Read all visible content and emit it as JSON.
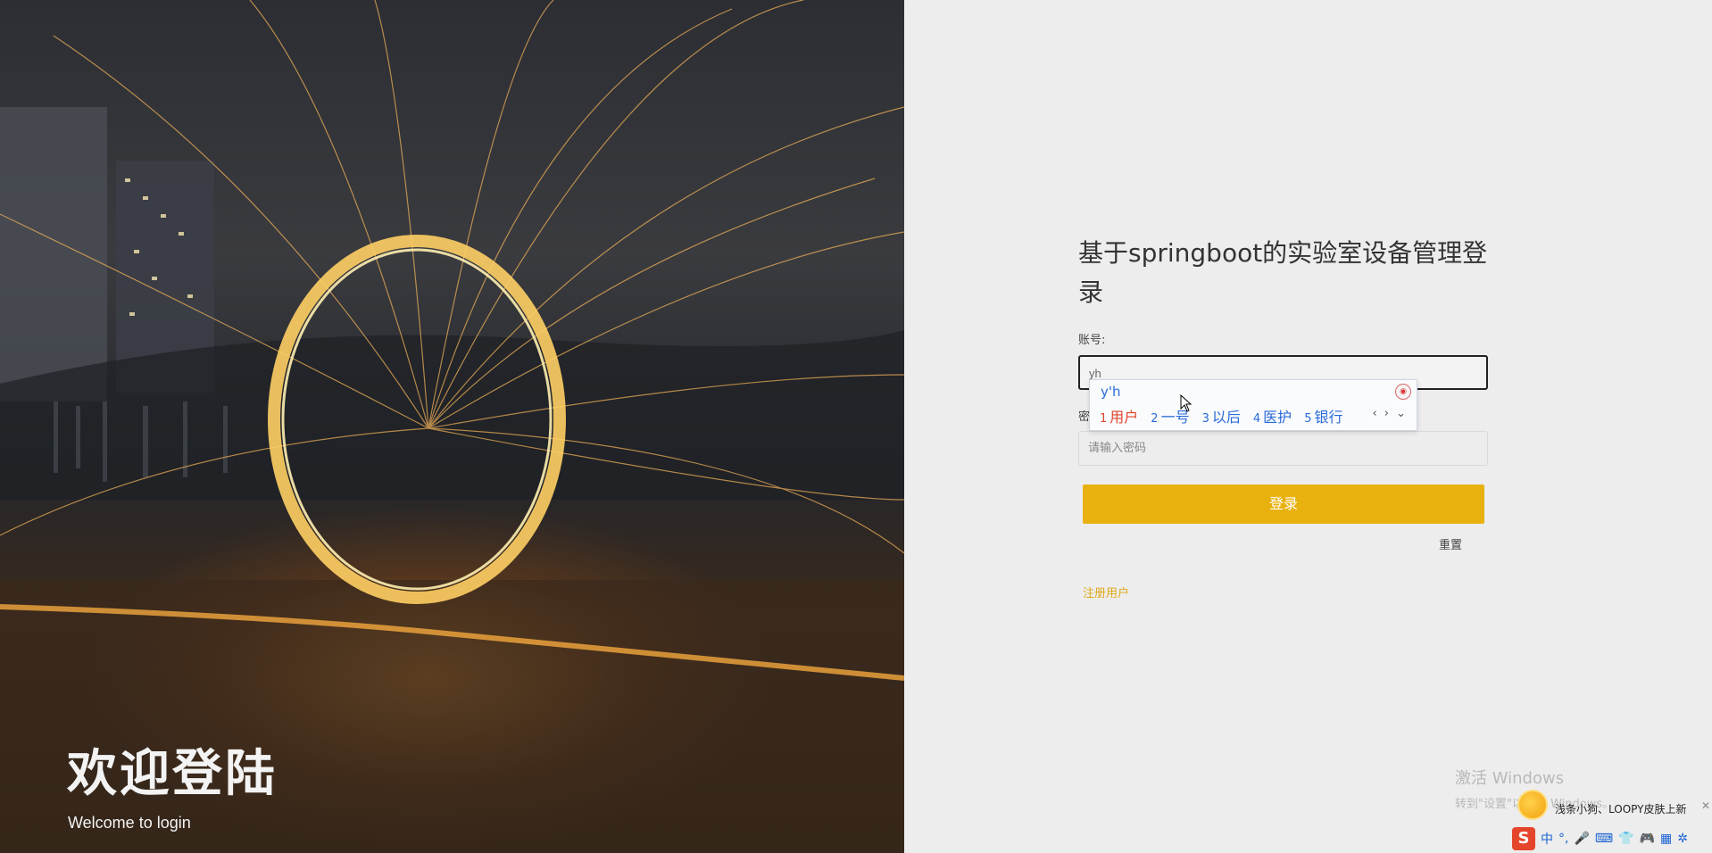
{
  "hero": {
    "title": "欢迎登陆",
    "subtitle": "Welcome to login"
  },
  "login": {
    "title": "基于springboot的实验室设备管理登录",
    "username_label": "账号:",
    "username_value": "yh",
    "password_label": "密码:",
    "password_placeholder": "请输入密码",
    "login_button": "登录",
    "reset_button": "重置",
    "register_link": "注册用户"
  },
  "ime": {
    "pinyin": "y'h",
    "candidates": [
      {
        "num": "1",
        "text": "用户"
      },
      {
        "num": "2",
        "text": "一号"
      },
      {
        "num": "3",
        "text": "以后"
      },
      {
        "num": "4",
        "text": "医护"
      },
      {
        "num": "5",
        "text": "银行"
      }
    ],
    "nav": "‹ › ⌄"
  },
  "watermark": {
    "line1": "激活 Windows",
    "line2": "转到\"设置\"以激活 Windows。"
  },
  "notification": {
    "text": "浅条小狗、LOOPY皮肤上新",
    "close": "✕"
  },
  "tray": {
    "sogou": "S",
    "lang": "中",
    "punct": "°,",
    "mic": "🎤",
    "keyboard": "⌨",
    "shirt": "👕",
    "game": "🎮",
    "grid": "▦",
    "star": "✲"
  },
  "colors": {
    "accent": "#e8b10e",
    "link": "#e0a817",
    "ime_blue": "#2a6bd8",
    "ime_selected": "#e0432b"
  }
}
